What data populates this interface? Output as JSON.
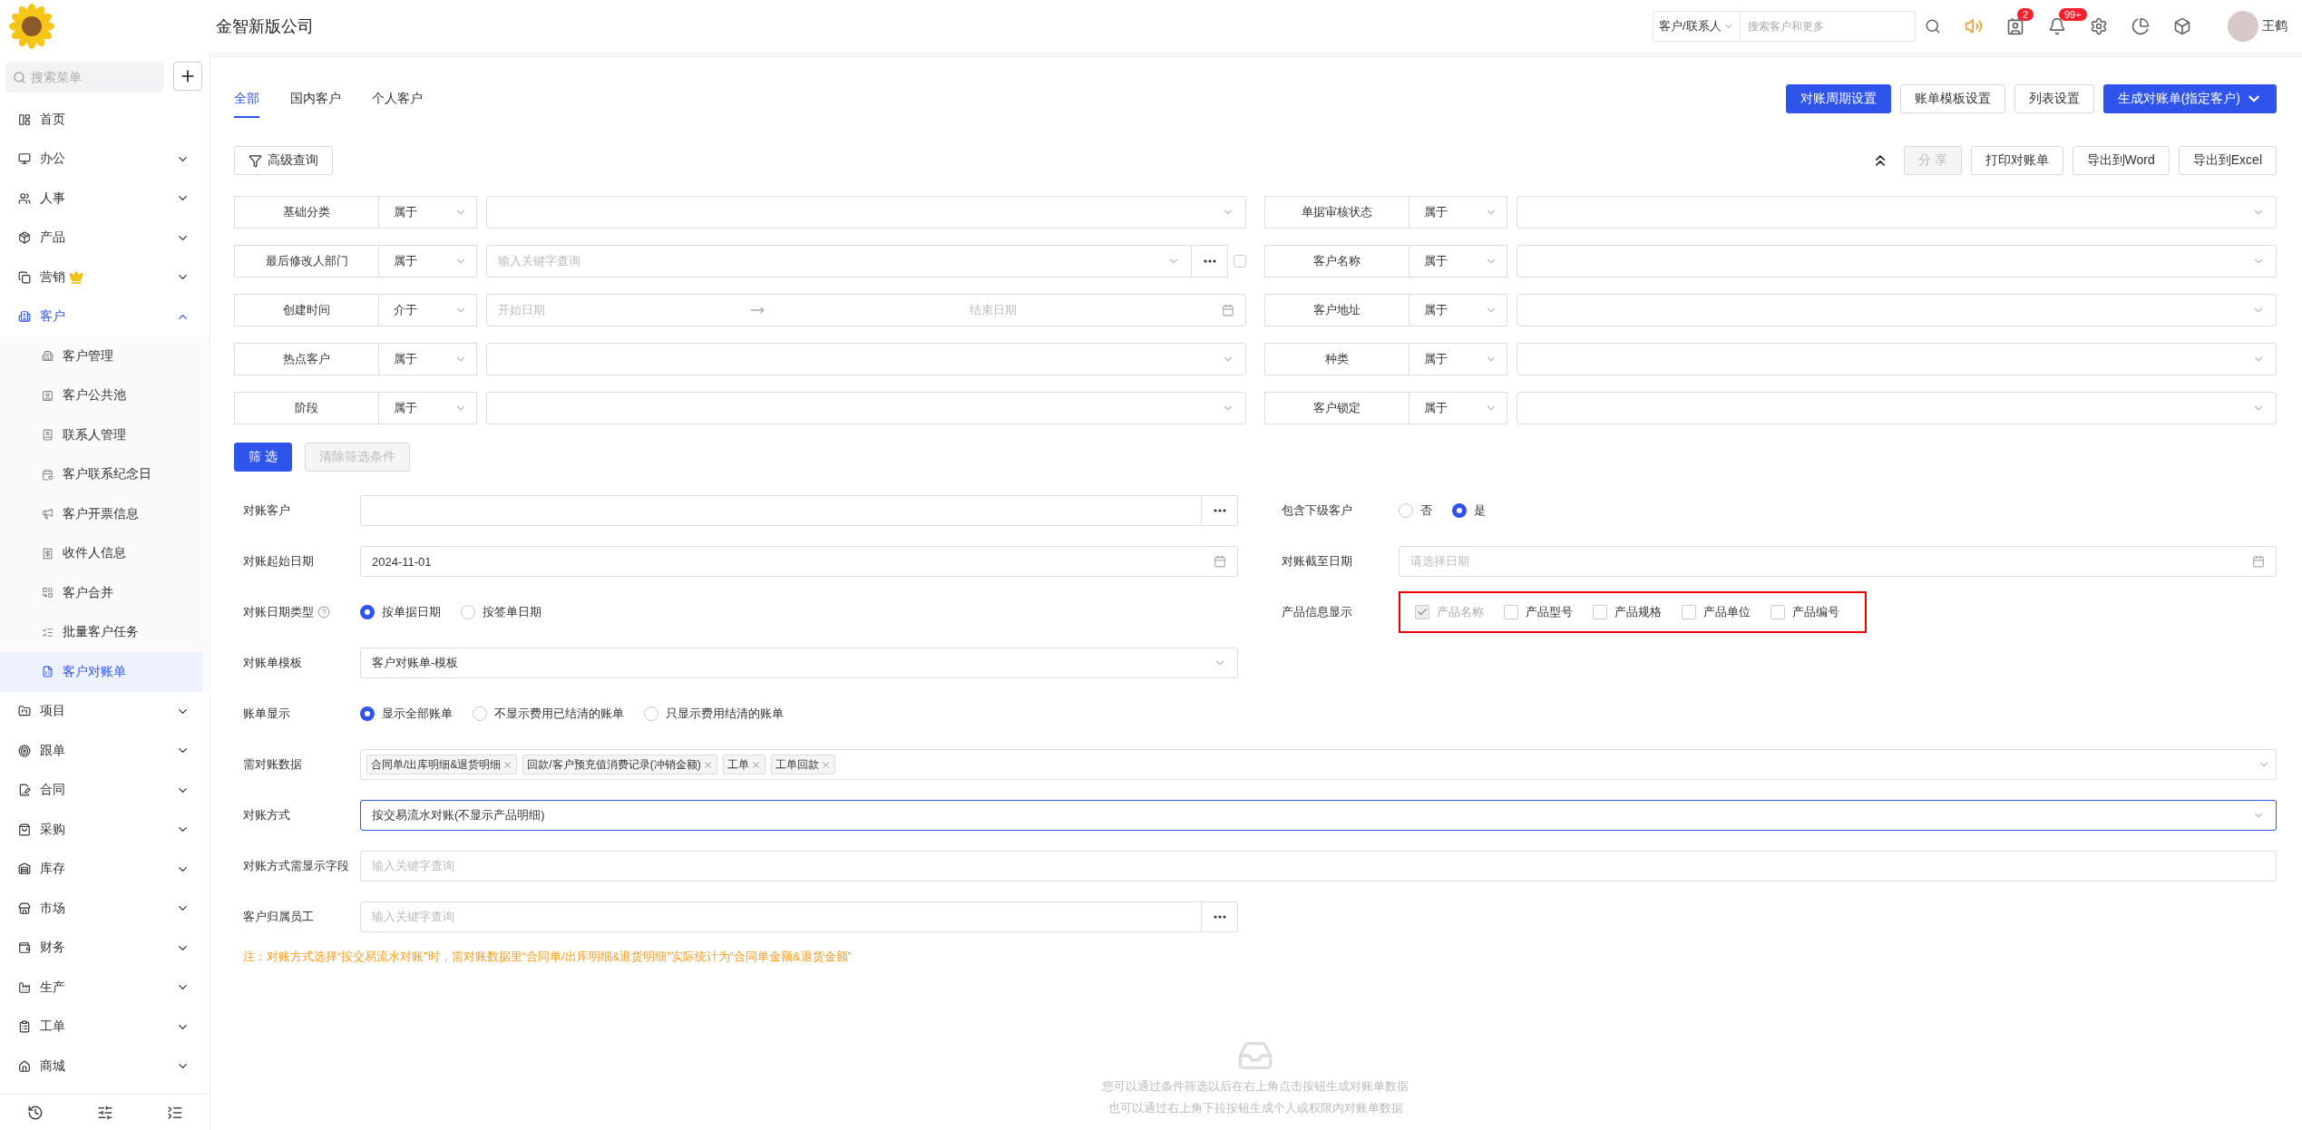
{
  "header": {
    "company": "金智新版公司",
    "search_scope": "客户/联系人",
    "search_placeholder": "搜索客户和更多",
    "actions": [
      {
        "kind": "speaker"
      },
      {
        "kind": "contacts",
        "badge": "2"
      },
      {
        "kind": "bell",
        "badge": "99+"
      },
      {
        "kind": "settings"
      },
      {
        "kind": "chart"
      },
      {
        "kind": "cube"
      }
    ],
    "user": "王鹤"
  },
  "sidebar": {
    "search_placeholder": "搜索菜单",
    "items": [
      {
        "label": "首页",
        "selected": false
      },
      {
        "label": "办公",
        "selected": false,
        "expanded": false
      },
      {
        "label": "人事",
        "selected": false,
        "expanded": false
      },
      {
        "label": "产品",
        "selected": false,
        "expanded": false
      },
      {
        "label": "营销",
        "selected": false,
        "expanded": false,
        "crown": true
      },
      {
        "label": "客户",
        "selected": true,
        "expanded": true,
        "children": [
          {
            "label": "客户管理",
            "selected": false
          },
          {
            "label": "客户公共池",
            "selected": false
          },
          {
            "label": "联系人管理",
            "selected": false
          },
          {
            "label": "客户联系纪念日",
            "selected": false
          },
          {
            "label": "客户开票信息",
            "selected": false
          },
          {
            "label": "收件人信息",
            "selected": false
          },
          {
            "label": "客户合并",
            "selected": false
          },
          {
            "label": "批量客户任务",
            "selected": false
          },
          {
            "label": "客户对账单",
            "selected": true
          }
        ]
      },
      {
        "label": "项目",
        "selected": false,
        "expanded": false
      },
      {
        "label": "跟单",
        "selected": false,
        "expanded": false
      },
      {
        "label": "合同",
        "selected": false,
        "expanded": false
      },
      {
        "label": "采购",
        "selected": false,
        "expanded": false
      },
      {
        "label": "库存",
        "selected": false,
        "expanded": false
      },
      {
        "label": "市场",
        "selected": false,
        "expanded": false
      },
      {
        "label": "财务",
        "selected": false,
        "expanded": false
      },
      {
        "label": "生产",
        "selected": false,
        "expanded": false
      },
      {
        "label": "工单",
        "selected": false,
        "expanded": false
      },
      {
        "label": "商城",
        "selected": false,
        "expanded": false
      }
    ]
  },
  "tabs": [
    {
      "label": "全部",
      "selected": true
    },
    {
      "label": "国内客户",
      "selected": false
    },
    {
      "label": "个人客户",
      "selected": false
    }
  ],
  "toolbar_buttons": [
    {
      "label": "对账周期设置",
      "kind": "primary"
    },
    {
      "label": "账单模板设置",
      "kind": "default"
    },
    {
      "label": "列表设置",
      "kind": "default"
    },
    {
      "label": "生成对账单(指定客户)",
      "kind": "primary_dropdown"
    }
  ],
  "advanced_query": "高级查询",
  "export_buttons": [
    {
      "label": "分 享",
      "disabled": true
    },
    {
      "label": "打印对账单",
      "disabled": false
    },
    {
      "label": "导出到Word",
      "disabled": false
    },
    {
      "label": "导出到Excel",
      "disabled": false
    }
  ],
  "filters": [
    {
      "label": "基础分类",
      "operator": "属于",
      "kind": "select"
    },
    {
      "label": "单据审核状态",
      "operator": "属于",
      "kind": "select"
    },
    {
      "label": "最后修改人部门",
      "operator": "属于",
      "kind": "keyword",
      "placeholder": "输入关键字查询",
      "checked": false
    },
    {
      "label": "客户名称",
      "operator": "属于",
      "kind": "select"
    },
    {
      "label": "创建时间",
      "operator": "介于",
      "kind": "date_range",
      "start_placeholder": "开始日期",
      "end_placeholder": "结束日期"
    },
    {
      "label": "客户地址",
      "operator": "属于",
      "kind": "select"
    },
    {
      "label": "热点客户",
      "operator": "属于",
      "kind": "select"
    },
    {
      "label": "种类",
      "operator": "属于",
      "kind": "select"
    },
    {
      "label": "阶段",
      "operator": "属于",
      "kind": "select"
    },
    {
      "label": "客户锁定",
      "operator": "属于",
      "kind": "select"
    }
  ],
  "filter_actions": {
    "apply": "筛 选",
    "clear": "清除筛选条件",
    "clear_disabled": true
  },
  "form": {
    "top_fields": [
      {
        "label": "对账客户",
        "kind": "picker"
      },
      {
        "label": "包含下级客户",
        "kind": "radio",
        "options": [
          {
            "label": "否",
            "selected": false
          },
          {
            "label": "是",
            "selected": true
          }
        ]
      },
      {
        "label": "对账起始日期",
        "kind": "date",
        "value": "2024-11-01"
      },
      {
        "label": "对账截至日期",
        "kind": "date",
        "placeholder": "请选择日期"
      },
      {
        "label": "对账日期类型",
        "kind": "radio",
        "help": true,
        "options": [
          {
            "label": "按单据日期",
            "selected": true
          },
          {
            "label": "按签单日期",
            "selected": false
          }
        ]
      },
      {
        "label": "产品信息显示",
        "kind": "checkbox",
        "highlighted": true,
        "options": [
          {
            "label": "产品名称",
            "checked": true,
            "disabled": true
          },
          {
            "label": "产品型号",
            "checked": false,
            "disabled": false
          },
          {
            "label": "产品规格",
            "checked": false,
            "disabled": false
          },
          {
            "label": "产品单位",
            "checked": false,
            "disabled": false
          },
          {
            "label": "产品编号",
            "checked": false,
            "disabled": false
          }
        ]
      },
      {
        "label": "对账单模板",
        "kind": "select",
        "value": "客户对账单-模板"
      }
    ],
    "wide_fields": [
      {
        "label": "账单显示",
        "kind": "radio",
        "options": [
          {
            "label": "显示全部账单",
            "selected": true
          },
          {
            "label": "不显示费用已结清的账单",
            "selected": false
          },
          {
            "label": "只显示费用结清的账单",
            "selected": false
          }
        ]
      },
      {
        "label": "需对账数据",
        "kind": "tags",
        "tags": [
          "合同单/出库明细&退货明细",
          "回款/客户预充值消费记录(冲销金额)",
          "工单",
          "工单回款"
        ]
      },
      {
        "label": "对账方式",
        "kind": "select",
        "value": "按交易流水对账(不显示产品明细)",
        "focused": true
      },
      {
        "label": "对账方式需显示字段",
        "kind": "text",
        "placeholder": "输入关键字查询"
      }
    ],
    "bottom_fields": [
      {
        "label": "客户归属员工",
        "kind": "picker",
        "placeholder": "输入关键字查询"
      }
    ],
    "note": "注：对账方式选择“按交易流水对账”时，需对账数据里“合同单/出库明细&退货明细”实际统计为“合同单金额&退货金额”"
  },
  "empty_state": [
    "您可以通过条件筛选以后在右上角点击按钮生成对账单数据",
    "也可以通过右上角下拉按钮生成个人或权限内对账单数据"
  ]
}
